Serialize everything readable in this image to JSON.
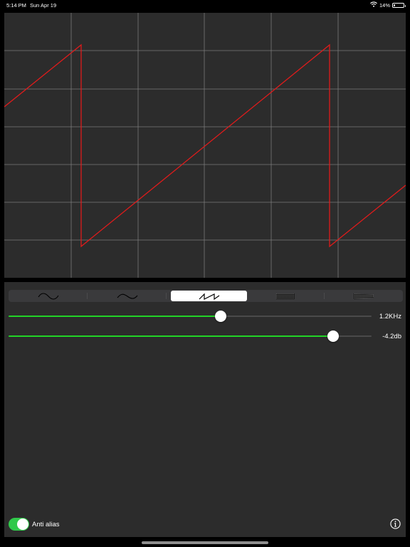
{
  "status_bar": {
    "time": "5:14 PM",
    "date": "Sun Apr 19",
    "battery_text": "14%",
    "battery_level": 0.14,
    "icons": [
      "wifi-icon",
      "battery-icon"
    ]
  },
  "oscilloscope": {
    "waveform": "sawtooth",
    "trace_color": "#e01b1b",
    "grid_color": "#7a7a7a",
    "background": "#2c2c2c",
    "grid_columns": 6,
    "grid_rows": 7
  },
  "controls": {
    "waveform_selector": {
      "options": [
        "sine-wave-icon",
        "triangle-wave-icon",
        "sawtooth-wave-icon",
        "square-wave-icon",
        "noise-wave-icon"
      ],
      "selected_index": 2
    },
    "frequency_slider": {
      "value": 0.585,
      "label": "1.2KHz"
    },
    "amplitude_slider": {
      "value": 0.895,
      "label": "-4.2db"
    },
    "anti_alias": {
      "label": "Anti alias",
      "enabled": true
    },
    "accent_color": "#22d427",
    "toggle_color": "#30c94a"
  }
}
